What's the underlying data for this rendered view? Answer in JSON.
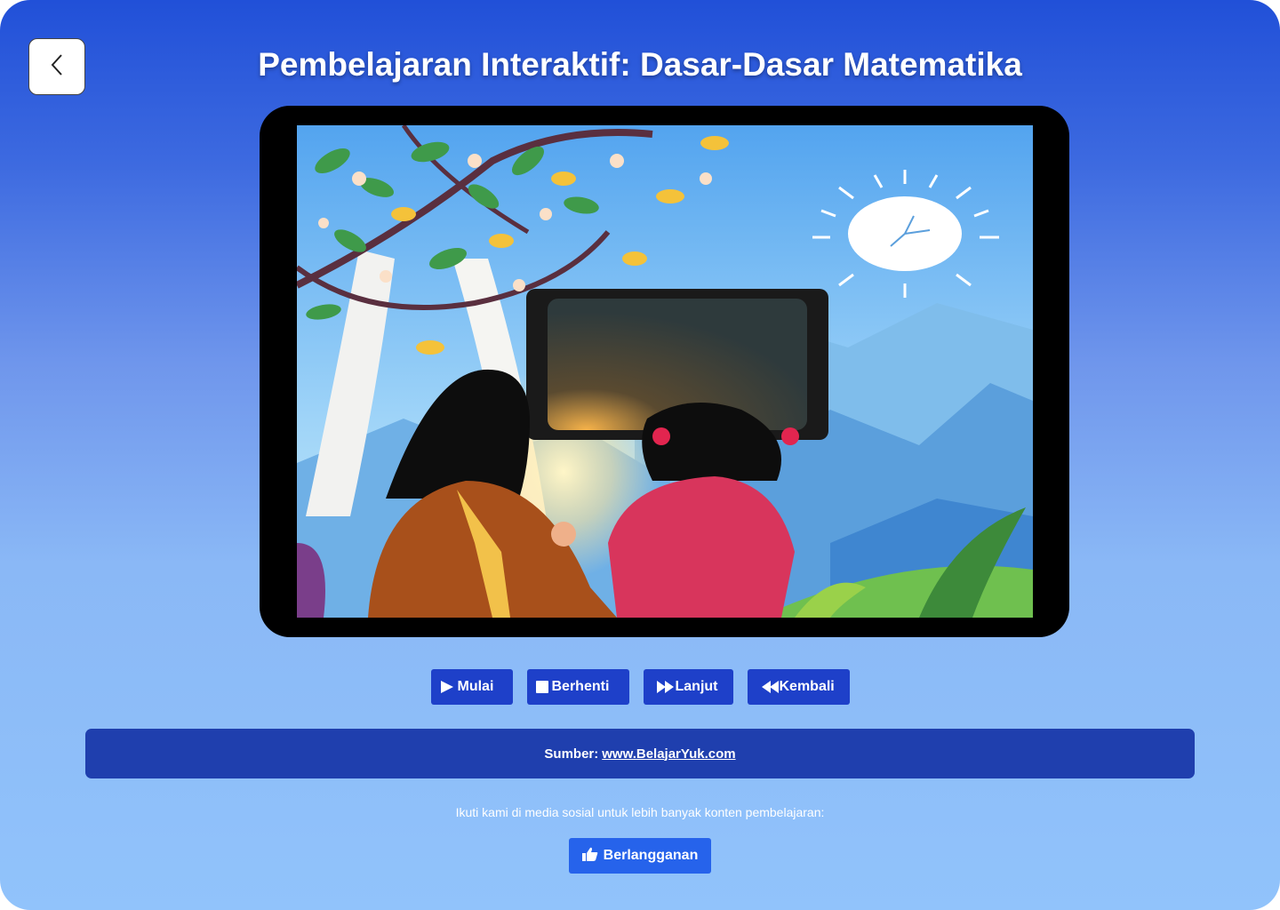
{
  "header": {
    "title": "Pembelajaran Interaktif: Dasar-Dasar Matematika",
    "back_icon": "chevron-left-icon"
  },
  "player": {
    "image_description_icon": "video-frame"
  },
  "controls": [
    {
      "label": "Mulai",
      "icon": "play-icon"
    },
    {
      "label": "Berhenti",
      "icon": "stop-icon"
    },
    {
      "label": "Lanjut",
      "icon": "fast-forward-icon"
    },
    {
      "label": "Kembali",
      "icon": "rewind-icon"
    }
  ],
  "source": {
    "prefix": "Sumber:",
    "link_text": "www.BelajarYuk.com"
  },
  "social": {
    "text": "Ikuti kami di media sosial untuk lebih banyak konten pembelajaran:",
    "subscribe_label": "Berlangganan",
    "subscribe_icon": "thumbs-up-icon"
  },
  "colors": {
    "primary": "#1e40c9",
    "source_bar": "#1f3fae",
    "subscribe": "#2663eb",
    "bg_top": "#2150d8",
    "bg_bottom": "#91c3fb"
  }
}
